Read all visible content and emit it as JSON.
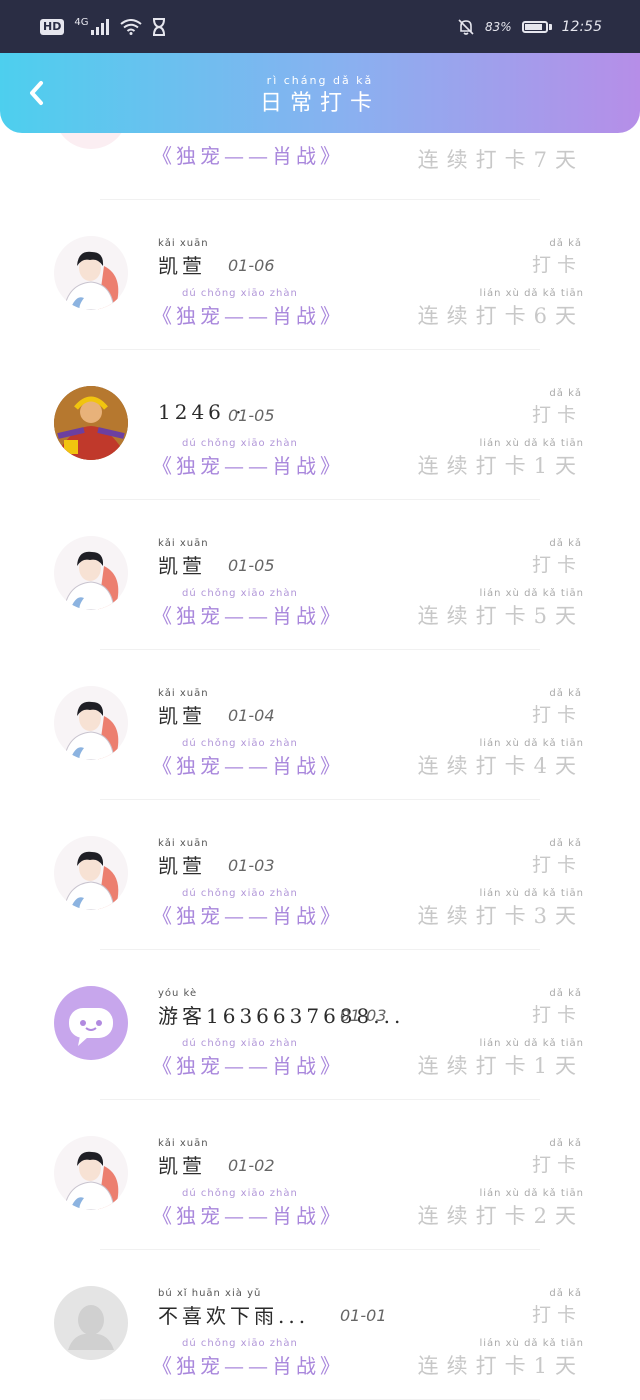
{
  "status": {
    "hd": "HD",
    "network": "4G",
    "battery_pct": "83%",
    "battery_level": 0.83,
    "time": "12:55"
  },
  "header": {
    "title_pinyin": "rì cháng dǎ kǎ",
    "title": "日常打卡",
    "back_icon": "chevron-left-icon"
  },
  "common": {
    "fav_pinyin": "dú chǒng xiāo zhàn",
    "fav_text": "《独宠——肖战》",
    "checkin_pinyin": "dǎ kǎ",
    "checkin_text": "打卡",
    "streak_pinyin": "lián xù dǎ kǎ tiān"
  },
  "partial_row": {
    "streak": "连续打卡7天"
  },
  "rows": [
    {
      "name_pinyin": "kǎi xuān",
      "name": "凯萱",
      "date": "01-06",
      "streak": "连续打卡6天",
      "avatar": "anime-boy"
    },
    {
      "name_pinyin": "",
      "name": "1246 ·",
      "date": "01-05",
      "streak": "连续打卡1天",
      "avatar": "warrior"
    },
    {
      "name_pinyin": "kǎi xuān",
      "name": "凯萱",
      "date": "01-05",
      "streak": "连续打卡5天",
      "avatar": "anime-boy"
    },
    {
      "name_pinyin": "kǎi xuān",
      "name": "凯萱",
      "date": "01-04",
      "streak": "连续打卡4天",
      "avatar": "anime-boy"
    },
    {
      "name_pinyin": "kǎi xuān",
      "name": "凯萱",
      "date": "01-03",
      "streak": "连续打卡3天",
      "avatar": "anime-boy"
    },
    {
      "name_pinyin": "yóu kè",
      "name": "游客1636637688...",
      "date": "01-03",
      "streak": "连续打卡1天",
      "avatar": "guest"
    },
    {
      "name_pinyin": "kǎi xuān",
      "name": "凯萱",
      "date": "01-02",
      "streak": "连续打卡2天",
      "avatar": "anime-boy"
    },
    {
      "name_pinyin": "bú xǐ huān xià yǔ",
      "name": "不喜欢下雨...",
      "date": "01-01",
      "streak": "连续打卡1天",
      "avatar": "default"
    }
  ],
  "colors": {
    "header_start": "#4dcfee",
    "header_end": "#b68ee8",
    "fav": "#a987dc",
    "muted": "#c8c8c8"
  }
}
